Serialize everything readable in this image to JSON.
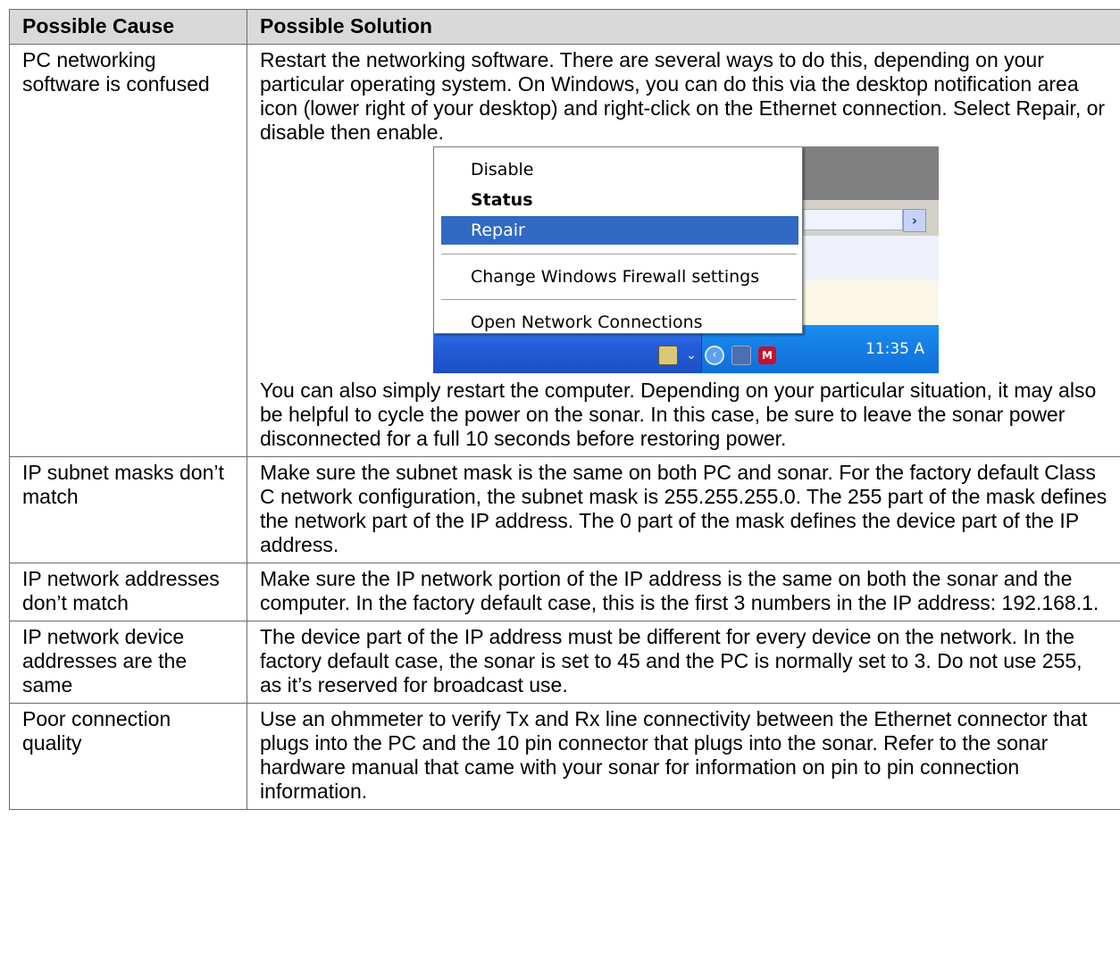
{
  "table": {
    "headers": [
      "Possible Cause",
      "Possible Solution"
    ],
    "rows": [
      {
        "cause": "PC networking software is confused",
        "solution": "Restart the networking software. There are several ways to do this, depending on your particular operating system. On Windows, you can do this via the desktop notification area icon (lower right of your desktop) and right-click on the Ethernet connection. Select Repair, or disable then enable.",
        "solution_after": "You can also simply restart the computer. Depending on your particular situation, it may also be helpful to cycle the power on the sonar. In this case, be sure to leave the sonar power disconnected for a full 10 seconds before restoring power."
      },
      {
        "cause": "IP subnet masks don’t match",
        "solution": "Make sure the subnet mask is the same on both PC and sonar. For the factory default Class C network configuration, the subnet mask is 255.255.255.0. The 255 part of the mask defines the network part of the IP address. The 0 part of the mask defines the device part of the IP address."
      },
      {
        "cause": "IP network addresses don’t match",
        "solution": "Make sure the IP network portion of the IP address is the same on both the sonar and the computer. In the factory default case, this is the first 3 numbers in the IP address: 192.168.1."
      },
      {
        "cause": "IP network device addresses are the same",
        "solution": "The device part of the IP address must be different for every device on the network. In the factory default case, the sonar is set to 45 and the PC is normally set to 3. Do not use 255, as it’s reserved for broadcast use."
      },
      {
        "cause": "Poor connection quality",
        "solution": "Use an ohmmeter to verify Tx and Rx line connectivity between the Ethernet connector that plugs into the PC and the 10 pin connector that plugs into the sonar. Refer to the sonar hardware manual that came with your sonar for information on pin to pin connection information."
      }
    ]
  },
  "screenshot": {
    "menu_items": [
      "Disable",
      "Status",
      "Repair",
      "Change Windows Firewall settings",
      "Open Network Connections"
    ],
    "highlighted_item": "Repair",
    "default_item": "Status",
    "clock": "11:35 A",
    "tray_badge": "M",
    "scroll_arrow": "›",
    "taskbar_color": "#245edb",
    "highlight_color": "#316ac5"
  }
}
